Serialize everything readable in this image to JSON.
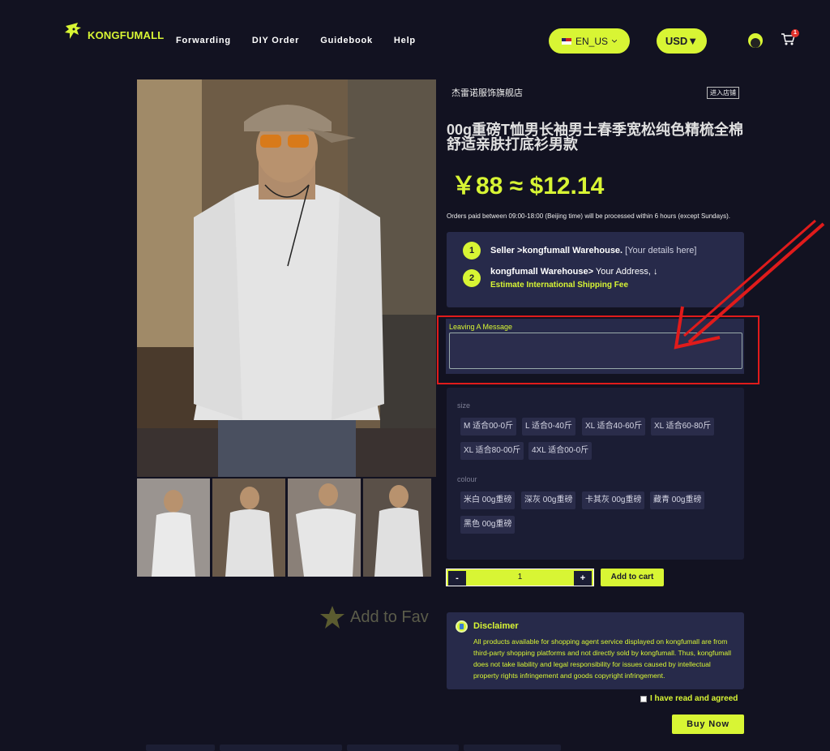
{
  "header": {
    "brand": "KONGFUMALL",
    "nav": [
      "Forwarding",
      "DIY Order",
      "Guidebook",
      "Help"
    ],
    "language": "EN_US",
    "currency": "USD▼",
    "cart_count": "1",
    "icons": {
      "logo": "kongfu-mascot-icon",
      "flag": "us-flag-icon",
      "avatar": "avatar-icon",
      "cart": "cart-icon"
    }
  },
  "product": {
    "shop_name": "杰雷诺服饰旗舰店",
    "enter_shop": "进入店铺",
    "title": "00g重磅T恤男长袖男士春季宽松纯色精梳全棉舒适亲肤打底衫男款",
    "price": "￥88 ≈ $12.14",
    "orders_note": "Orders paid between 09:00-18:00 (Beijing time) will be processed within 6 hours (except Sundays)."
  },
  "steps": {
    "step1": {
      "num": "1",
      "seller": "Seller >kongfumall Warehouse.",
      "details": "[Your details here]"
    },
    "step2": {
      "num": "2",
      "warehouse": "kongfumall Warehouse>",
      "address": "Your Address, ↓",
      "ship_link": "Estimate International Shipping Fee"
    }
  },
  "message": {
    "label": "Leaving A Message",
    "placeholder": ""
  },
  "options": {
    "size_label": "size",
    "sizes": [
      "M 适合00-0斤",
      "L 适合0-40斤",
      "XL 适合40-60斤",
      "XL 适合60-80斤",
      "XL 适合80-00斤",
      "4XL 适合00-0斤"
    ],
    "colour_label": "colour",
    "colours": [
      "米白 00g重磅",
      "深灰 00g重磅",
      "卡其灰 00g重磅",
      "藏青 00g重磅",
      "黑色 00g重磅"
    ]
  },
  "cart": {
    "minus": "-",
    "quantity": "1",
    "plus": "+",
    "add_to_cart": "Add to cart"
  },
  "favorite": {
    "label": "Add to Fav",
    "icon": "star-icon"
  },
  "disclaimer": {
    "title": "Disclaimer",
    "text": "All products available for shopping agent service displayed on kongfumall are from third-party shopping platforms and not directly sold by kongfumall. Thus, kongfumall does not take liability and legal responsibility for issues caused by intellectual property rights infringement and goods copyright infringement.",
    "icon": "info-icon"
  },
  "agree_text": "I have read and agreed",
  "buy_now": "Buy Now",
  "colors": {
    "accent": "#d8f534",
    "background": "#121221",
    "panel": "#272a4a",
    "annotation": "#e01b1b"
  }
}
